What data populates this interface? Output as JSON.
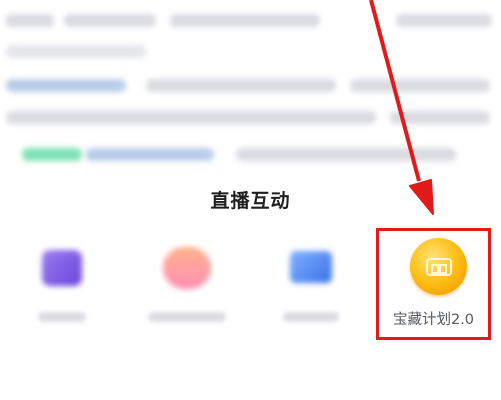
{
  "section": {
    "title": "直播互动"
  },
  "interactions": [
    {
      "label": "",
      "icon": "purple-cup-icon"
    },
    {
      "label": "",
      "icon": "pink-gift-icon"
    },
    {
      "label": "",
      "icon": "blue-box-icon"
    },
    {
      "label": "宝藏计划2.0",
      "icon": "gold-treasure-coin-icon",
      "highlighted": true
    }
  ],
  "colors": {
    "highlight_border": "#e21a1a",
    "arrow": "#e21a1a",
    "coin": "#ffc21a",
    "title_text": "#1f1f1f",
    "label_text": "#555a63"
  }
}
